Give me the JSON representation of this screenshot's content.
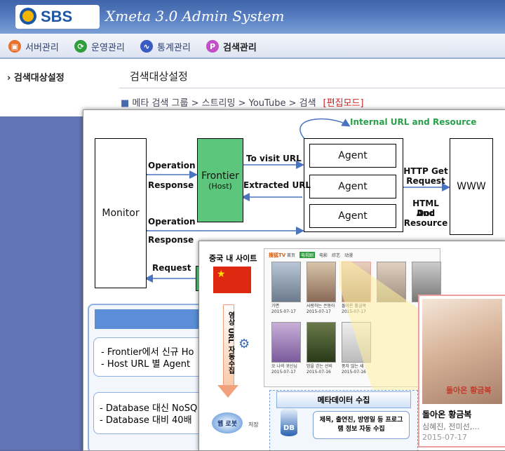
{
  "header": {
    "logo_text": "SBS",
    "app_title": "Xmeta 3.0  Admin System"
  },
  "nav": [
    {
      "label": "서버관리",
      "icon": "server-icon",
      "color": "#e8702a"
    },
    {
      "label": "운영관리",
      "icon": "operation-icon",
      "color": "#2e9e3a"
    },
    {
      "label": "통계관리",
      "icon": "stats-icon",
      "color": "#3a5bbf"
    },
    {
      "label": "검색관리",
      "icon": "search-manage-icon",
      "color": "#c24fc6"
    }
  ],
  "sidebar": {
    "item": "검색대상설정"
  },
  "main": {
    "title": "검색대상설정",
    "breadcrumb": "메타 검색 그룹 > 스트리밍 > YouTube > 검색",
    "mode": "[편집모드]"
  },
  "diagram": {
    "monitor": "Monitor",
    "frontier": "Frontier",
    "frontier_sub": "(Host)",
    "agents": [
      "Agent",
      "Agent",
      "Agent"
    ],
    "www": "WWW",
    "internal": "Internal URL and Resource",
    "to_visit": "To visit URL",
    "extracted": "Extracted URL",
    "operation": "Operation",
    "response": "Response",
    "request": "Request",
    "http_get": "HTTP Get",
    "http_request": "Request",
    "html_doc": "HTML Doc",
    "and": "And",
    "resource": "Resource",
    "bullets1": [
      "-   Frontier에서 신규 Ho",
      "-   Host URL 별 Agent"
    ],
    "bullets2": [
      "- Database 대신 NoSQ",
      "- Database 대비 40배"
    ]
  },
  "china": {
    "site_label": "중국 내 사이트",
    "vertical_label": "영상 URL 자동수집",
    "meta_title": "메타데이터 수집",
    "meta_body": "제목, 출연진, 방영일 등 프로그램 정보 자동 수집",
    "robot": "웹 로봇",
    "save": "저장",
    "db": "DB",
    "site_logo": "搜狐TV",
    "tabs": [
      "首页",
      "电视剧",
      "电影",
      "综艺",
      "动漫"
    ],
    "featured_title": "돌아온 황금복",
    "featured_cast": "심혜진, 전미선,...",
    "featured_date": "2015-07-17",
    "poster_text": "돌아온 황금복",
    "captions": [
      {
        "t": "가면",
        "d": "2015-07-17"
      },
      {
        "t": "사랑하는 은동아",
        "d": "2015-07-17"
      },
      {
        "t": "돌아온 황금복",
        "d": "2015-07-17"
      },
      {
        "t": "오 나의 귀신님",
        "d": "2015-07-17"
      },
      {
        "t": "밤을 걷는 선비",
        "d": "2015-07-16"
      },
      {
        "t": "풍자 않는 새",
        "d": "2015-07-16"
      }
    ]
  }
}
